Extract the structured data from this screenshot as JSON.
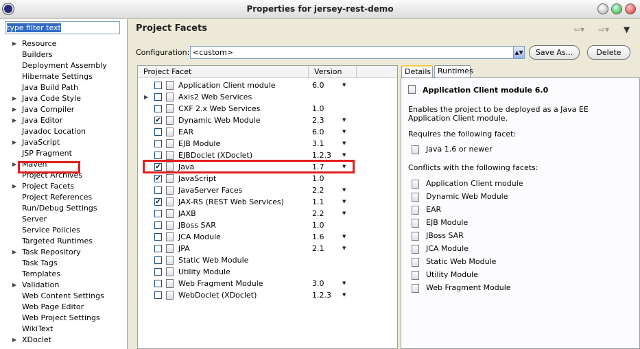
{
  "window": {
    "title": "Properties for jersey-rest-demo"
  },
  "left": {
    "filter_placeholder": "type filter text",
    "items": [
      {
        "label": "Resource",
        "expandable": true
      },
      {
        "label": "Builders",
        "expandable": false
      },
      {
        "label": "Deployment Assembly",
        "expandable": false
      },
      {
        "label": "Hibernate Settings",
        "expandable": false
      },
      {
        "label": "Java Build Path",
        "expandable": false
      },
      {
        "label": "Java Code Style",
        "expandable": true
      },
      {
        "label": "Java Compiler",
        "expandable": true
      },
      {
        "label": "Java Editor",
        "expandable": true
      },
      {
        "label": "Javadoc Location",
        "expandable": false
      },
      {
        "label": "JavaScript",
        "expandable": true
      },
      {
        "label": "JSP Fragment",
        "expandable": false
      },
      {
        "label": "Maven",
        "expandable": true
      },
      {
        "label": "Project Archives",
        "expandable": false
      },
      {
        "label": "Project Facets",
        "expandable": true,
        "selected": true
      },
      {
        "label": "Project References",
        "expandable": false
      },
      {
        "label": "Run/Debug Settings",
        "expandable": false
      },
      {
        "label": "Server",
        "expandable": false
      },
      {
        "label": "Service Policies",
        "expandable": false
      },
      {
        "label": "Targeted Runtimes",
        "expandable": false
      },
      {
        "label": "Task Repository",
        "expandable": true
      },
      {
        "label": "Task Tags",
        "expandable": false
      },
      {
        "label": "Templates",
        "expandable": false
      },
      {
        "label": "Validation",
        "expandable": true
      },
      {
        "label": "Web Content Settings",
        "expandable": false
      },
      {
        "label": "Web Page Editor",
        "expandable": false
      },
      {
        "label": "Web Project Settings",
        "expandable": false
      },
      {
        "label": "WikiText",
        "expandable": false
      },
      {
        "label": "XDoclet",
        "expandable": true
      }
    ]
  },
  "main": {
    "title": "Project Facets",
    "configuration_label": "Configuration:",
    "configuration_value": "<custom>",
    "save_as_label": "Save As...",
    "delete_label": "Delete",
    "col_facet": "Project Facet",
    "col_version": "Version",
    "facets": [
      {
        "label": "Application Client module",
        "version": "6.0",
        "checked": false,
        "dropdown": true,
        "expander": false
      },
      {
        "label": "Axis2 Web Services",
        "version": "",
        "checked": false,
        "dropdown": false,
        "expander": true
      },
      {
        "label": "CXF 2.x Web Services",
        "version": "1.0",
        "checked": false,
        "dropdown": false,
        "expander": false
      },
      {
        "label": "Dynamic Web Module",
        "version": "2.3",
        "checked": true,
        "dropdown": true,
        "expander": false
      },
      {
        "label": "EAR",
        "version": "6.0",
        "checked": false,
        "dropdown": true,
        "expander": false
      },
      {
        "label": "EJB Module",
        "version": "3.1",
        "checked": false,
        "dropdown": true,
        "expander": false
      },
      {
        "label": "EJBDoclet (XDoclet)",
        "version": "1.2.3",
        "checked": false,
        "dropdown": true,
        "expander": false
      },
      {
        "label": "Java",
        "version": "1.7",
        "checked": true,
        "dropdown": true,
        "expander": false
      },
      {
        "label": "JavaScript",
        "version": "1.0",
        "checked": true,
        "dropdown": false,
        "expander": false
      },
      {
        "label": "JavaServer Faces",
        "version": "2.2",
        "checked": false,
        "dropdown": true,
        "expander": false
      },
      {
        "label": "JAX-RS (REST Web Services)",
        "version": "1.1",
        "checked": true,
        "dropdown": true,
        "expander": false
      },
      {
        "label": "JAXB",
        "version": "2.2",
        "checked": false,
        "dropdown": true,
        "expander": false
      },
      {
        "label": "JBoss SAR",
        "version": "1.0",
        "checked": false,
        "dropdown": false,
        "expander": false
      },
      {
        "label": "JCA Module",
        "version": "1.6",
        "checked": false,
        "dropdown": true,
        "expander": false
      },
      {
        "label": "JPA",
        "version": "2.1",
        "checked": false,
        "dropdown": true,
        "expander": false
      },
      {
        "label": "Static Web Module",
        "version": "",
        "checked": false,
        "dropdown": false,
        "expander": false
      },
      {
        "label": "Utility Module",
        "version": "",
        "checked": false,
        "dropdown": false,
        "expander": false
      },
      {
        "label": "Web Fragment Module",
        "version": "3.0",
        "checked": false,
        "dropdown": true,
        "expander": false
      },
      {
        "label": "WebDoclet (XDoclet)",
        "version": "1.2.3",
        "checked": false,
        "dropdown": true,
        "expander": false
      }
    ]
  },
  "details": {
    "tab_details": "Details",
    "tab_runtimes": "Runtimes",
    "heading": "Application Client module 6.0",
    "description": "Enables the project to be deployed as a Java EE Application Client module.",
    "requires_label": "Requires the following facet:",
    "requires": [
      "Java 1.6 or newer"
    ],
    "conflicts_label": "Conflicts with the following facets:",
    "conflicts": [
      "Application Client module",
      "Dynamic Web Module",
      "EAR",
      "EJB Module",
      "JBoss SAR",
      "JCA Module",
      "Static Web Module",
      "Utility Module",
      "Web Fragment Module"
    ]
  }
}
